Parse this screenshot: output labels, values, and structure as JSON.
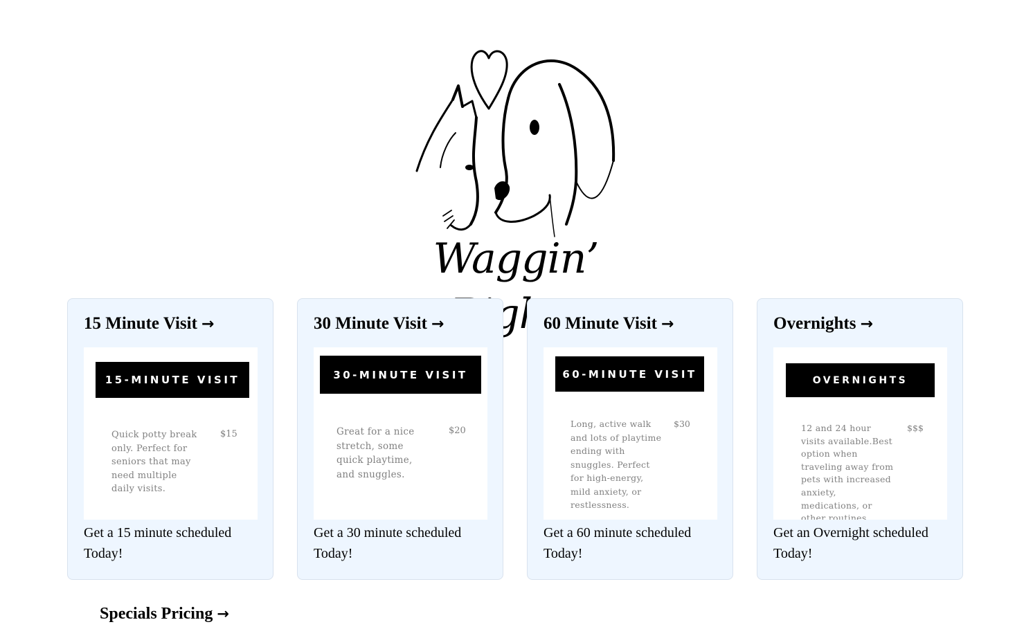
{
  "brand": {
    "name": "Waggin’ Rights",
    "logo_icon": "cat-dog-heart-logo"
  },
  "cards": [
    {
      "title": "15 Minute Visit",
      "arrow": "→",
      "banner": "15-MINUTE VISIT",
      "description": "Quick potty break only.  Perfect for seniors that may need multiple daily visits.",
      "price": "$15",
      "cta": "Get a 15 minute scheduled Today!"
    },
    {
      "title": "30 Minute Visit",
      "arrow": "→",
      "banner": "30-MINUTE VISIT",
      "description": "Great for a nice stretch, some quick playtime, and snuggles.",
      "price": "$20",
      "cta": "Get a 30 minute scheduled Today!"
    },
    {
      "title": "60 Minute Visit",
      "arrow": "→",
      "banner": "60-MINUTE VISIT",
      "description": "Long, active walk and lots of playtime ending with snuggles. Perfect for high-energy, mild anxiety, or restlessness.",
      "price": "$30",
      "cta": "Get a 60 minute scheduled Today!"
    },
    {
      "title": "Overnights",
      "arrow": "→",
      "banner": "OVERNIGHTS",
      "description": "12 and 24 hour visits available.Best option when traveling away from pets with increased anxiety, medications, or other routines.",
      "price": "$$$",
      "cta": "Get an Overnight scheduled Today!"
    }
  ],
  "specials": {
    "label": "Specials Pricing",
    "arrow": "→"
  },
  "colors": {
    "card_background": "#eef6ff",
    "banner_background": "#000000",
    "description_text": "#808080"
  }
}
